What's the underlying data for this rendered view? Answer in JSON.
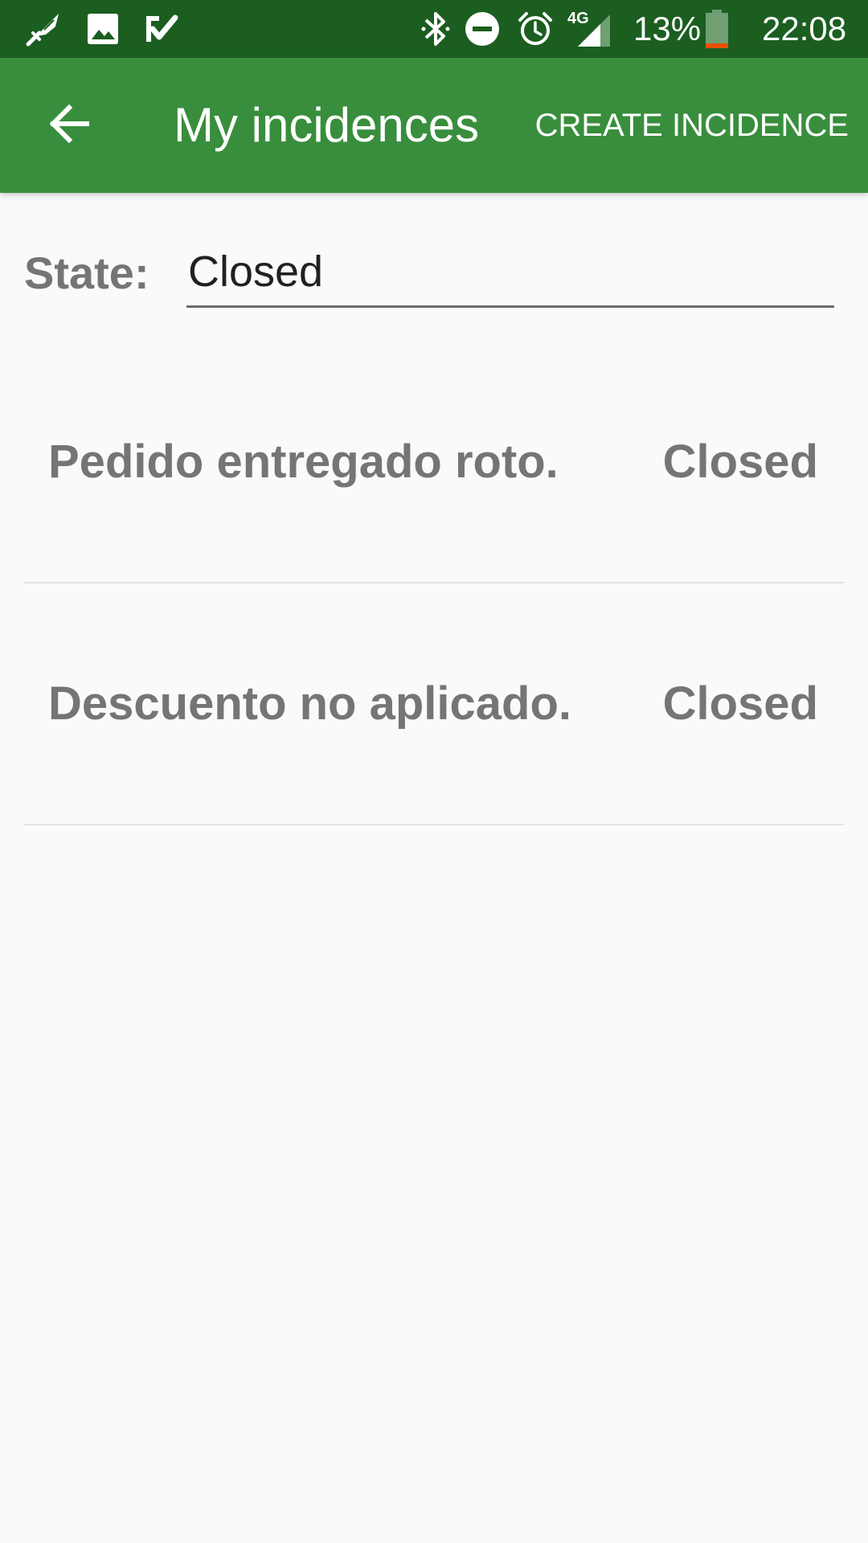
{
  "status_bar": {
    "notification_icons": [
      "feather-sword-app-icon",
      "image-icon",
      "check-app-icon"
    ],
    "system_icons": [
      "bluetooth-icon",
      "do-not-disturb-icon",
      "alarm-icon",
      "signal-4g-icon"
    ],
    "network_label": "4G",
    "battery_percent": "13%",
    "battery_level": 0.13,
    "time": "22:08"
  },
  "app_bar": {
    "back_icon": "arrow-left-icon",
    "title": "My incidences",
    "action_label": "CREATE INCIDENCE",
    "color": "#388e3c",
    "status_color": "#1b5e20"
  },
  "filter": {
    "label": "State:",
    "selected_value": "Closed"
  },
  "incidences": [
    {
      "title": "Pedido entregado roto.",
      "state": "Closed"
    },
    {
      "title": "Descuento no aplicado.",
      "state": "Closed"
    }
  ]
}
